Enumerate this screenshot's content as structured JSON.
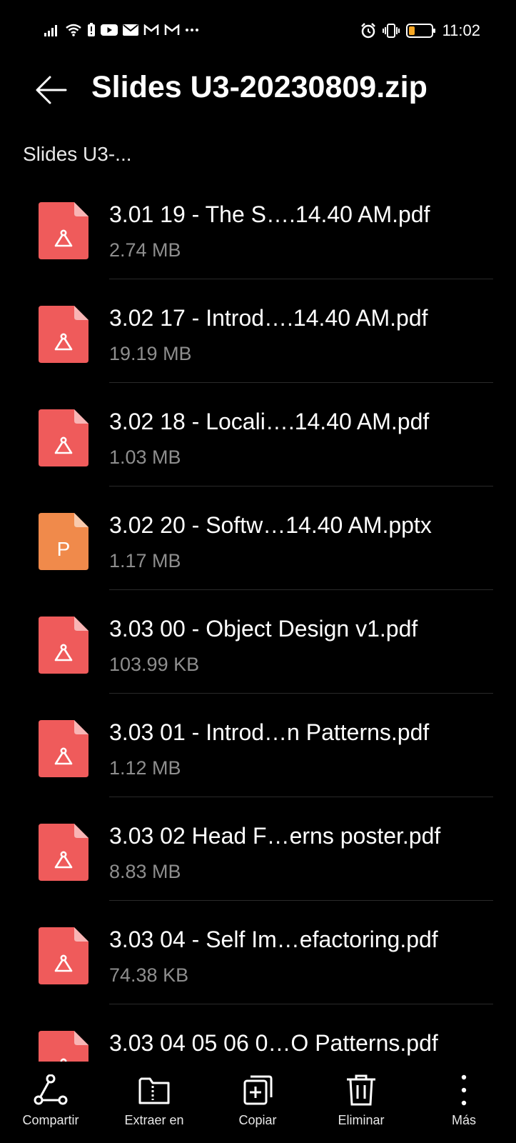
{
  "status_bar": {
    "time": "11:02",
    "left_icons": [
      "signal-icon",
      "wifi-icon",
      "battery-alert-icon",
      "youtube-icon",
      "mail-icon",
      "gmail-icon",
      "gmail-icon",
      "more-dots-icon"
    ],
    "right_icons": [
      "alarm-icon",
      "vibrate-icon",
      "battery-icon"
    ],
    "battery_color": "#f5a623"
  },
  "header": {
    "title": "Slides U3-20230809.zip",
    "back_icon": "arrow-left-icon"
  },
  "breadcrumb": "Slides U3-...",
  "files": [
    {
      "name": "3.01 19 - The S….14.40 AM.pdf",
      "size": "2.74 MB",
      "type": "pdf"
    },
    {
      "name": "3.02 17 - Introd….14.40 AM.pdf",
      "size": "19.19 MB",
      "type": "pdf"
    },
    {
      "name": "3.02 18 - Locali….14.40 AM.pdf",
      "size": "1.03 MB",
      "type": "pdf"
    },
    {
      "name": "3.02 20 - Softw…14.40 AM.pptx",
      "size": "1.17 MB",
      "type": "pptx"
    },
    {
      "name": "3.03 00 - Object Design v1.pdf",
      "size": "103.99 KB",
      "type": "pdf"
    },
    {
      "name": "3.03 01 - Introd…n Patterns.pdf",
      "size": "1.12 MB",
      "type": "pdf"
    },
    {
      "name": "3.03 02 Head F…erns poster.pdf",
      "size": "8.83 MB",
      "type": "pdf"
    },
    {
      "name": "3.03 04 - Self Im…efactoring.pdf",
      "size": "74.38 KB",
      "type": "pdf"
    },
    {
      "name": "3.03 04 05 06 0…O Patterns.pdf",
      "size": "",
      "type": "pdf"
    }
  ],
  "colors": {
    "pdf": "#ef5b5b",
    "pptx": "#f08a4b",
    "background": "#000000"
  },
  "pptx_letter": "P",
  "toolbar": {
    "share": "Compartir",
    "extract": "Extraer en",
    "copy": "Copiar",
    "delete": "Eliminar",
    "more": "Más"
  }
}
